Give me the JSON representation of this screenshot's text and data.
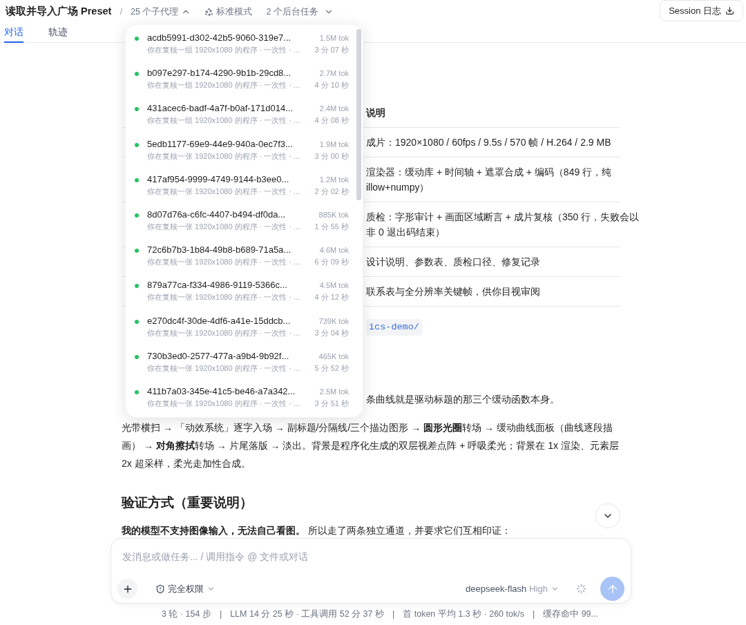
{
  "header": {
    "title": "读取并导入广场 Preset",
    "separator": "/",
    "subagents": {
      "label": "25 个子代理",
      "expanded": true
    },
    "mode": "标准模式",
    "background_tasks": "2 个后台任务",
    "session_button": "Session 日志"
  },
  "tabs": [
    {
      "label": "对话",
      "selected": true
    },
    {
      "label": "轨迹",
      "selected": false
    }
  ],
  "subagent_menu": {
    "items": [
      {
        "id": "acdb5991-d302-42b5-9060-319e7...",
        "description": "你在复核一组 1920x1080 的程序 · 一次性 · ...",
        "tokens": "1.5M tok",
        "duration": "3 分 07 秒"
      },
      {
        "id": "b097e297-b174-4290-9b1b-29cd8...",
        "description": "你在复核一组 1920x1080 的程序 · 一次性 · ...",
        "tokens": "2.7M tok",
        "duration": "4 分 10 秒"
      },
      {
        "id": "431acec6-badf-4a7f-b0af-171d014...",
        "description": "你在复核一组 1920x1080 的程序 · 一次性 · ...",
        "tokens": "2.4M tok",
        "duration": "4 分 08 秒"
      },
      {
        "id": "5edb1177-69e9-44e9-940a-0ec7f3...",
        "description": "你在复核一张 1920x1080 的程序 · 一次性 · ...",
        "tokens": "1.9M tok",
        "duration": "3 分 00 秒"
      },
      {
        "id": "417af954-9999-4749-9144-b3ee0...",
        "description": "你在复核一张 1920x1080 的程序 · 一次性 · ...",
        "tokens": "1.2M tok",
        "duration": "2 分 02 秒"
      },
      {
        "id": "8d07d76a-c6fc-4407-b494-df0da...",
        "description": "你在复核一张 1920x1080 的程序 · 一次性 · ...",
        "tokens": "885K tok",
        "duration": "1 分 55 秒"
      },
      {
        "id": "72c6b7b3-1b84-49b8-b689-71a5a...",
        "description": "你在复核一张 1920x1080 的程序 · 一次性 · ...",
        "tokens": "4.6M tok",
        "duration": "6 分 09 秒"
      },
      {
        "id": "879a77ca-f334-4986-9119-5366c...",
        "description": "你在复核一张 1920x1080 的程序 · 一次性 · ...",
        "tokens": "4.5M tok",
        "duration": "4 分 12 秒"
      },
      {
        "id": "e270dc4f-30de-4df6-a41e-15ddcb...",
        "description": "你在复核一张 1920x1080 的程序 · 一次性 · ...",
        "tokens": "739K tok",
        "duration": "3 分 04 秒"
      },
      {
        "id": "730b3ed0-2577-477a-a9b4-9b92f...",
        "description": "你在复核一张 1920x1080 的程序 · 一次性 · ...",
        "tokens": "465K tok",
        "duration": "5 分 52 秒"
      },
      {
        "id": "411b7a03-345e-41c5-be46-a7a342...",
        "description": "你在复核一张 1920x1080 的程序 · 一次性 · ...",
        "tokens": "2.5M tok",
        "duration": "3 分 51 秒"
      }
    ]
  },
  "table": {
    "header": "说明",
    "rows": [
      {
        "lines": [
          "成片：1920×1080 / 60fps / 9.5s / 570 帧 / H.264 / 2.9 MB"
        ]
      },
      {
        "lines": [
          "渲染器：缓动库 + 时间轴 + 遮罩合成 + 编码（849 行，纯",
          "illow+numpy）"
        ]
      },
      {
        "lines": [
          "质检：字形审计 + 画面区域断言 + 成片复核（350 行，失败会以",
          "非 0 退出码结束）"
        ]
      },
      {
        "lines": [
          "设计说明、参数表、质检口径、修复记录"
        ]
      },
      {
        "lines": [
          "联系表与全分辨率关键帧，供你目视审阅"
        ]
      }
    ]
  },
  "path_chip": "ics-demo/",
  "paragraphs": [
    "条曲线就是驱动标题的那三个缓动函数本身。",
    "光带横扫 → 「动效系统」逐字入场 → 副标题/分隔线/三个描边图形 → **圆形光圈**转场 → 缓动曲线面板（曲线逐段描画） → **对角擦拭**转场 → 片尾落版 → 淡出。背景是程序化生成的双层视差点阵 + 呼吸柔光；背景在 1x 渲染、元素层 2x 超采样，柔光走加性合成。"
  ],
  "section_heading": "验证方式（重要说明）",
  "note": "**我的模型不支持图像输入，无法自己看图。** 所以走了两条独立通道，并要求它们互相印证：",
  "composer": {
    "placeholder": "发消息或做任务... / 调用指令 @ 文件或对话",
    "permission": "完全权限",
    "model": "deepseek-flash",
    "effort": "High"
  },
  "footer": {
    "separator": "|",
    "stats": [
      "3 轮 · 154 步",
      "LLM 14 分 25 秒 · 工具调用 52 分 37 秒",
      "首 token 平均 1.3 秒 · 260 tok/s",
      "缓存命中 99..."
    ]
  }
}
